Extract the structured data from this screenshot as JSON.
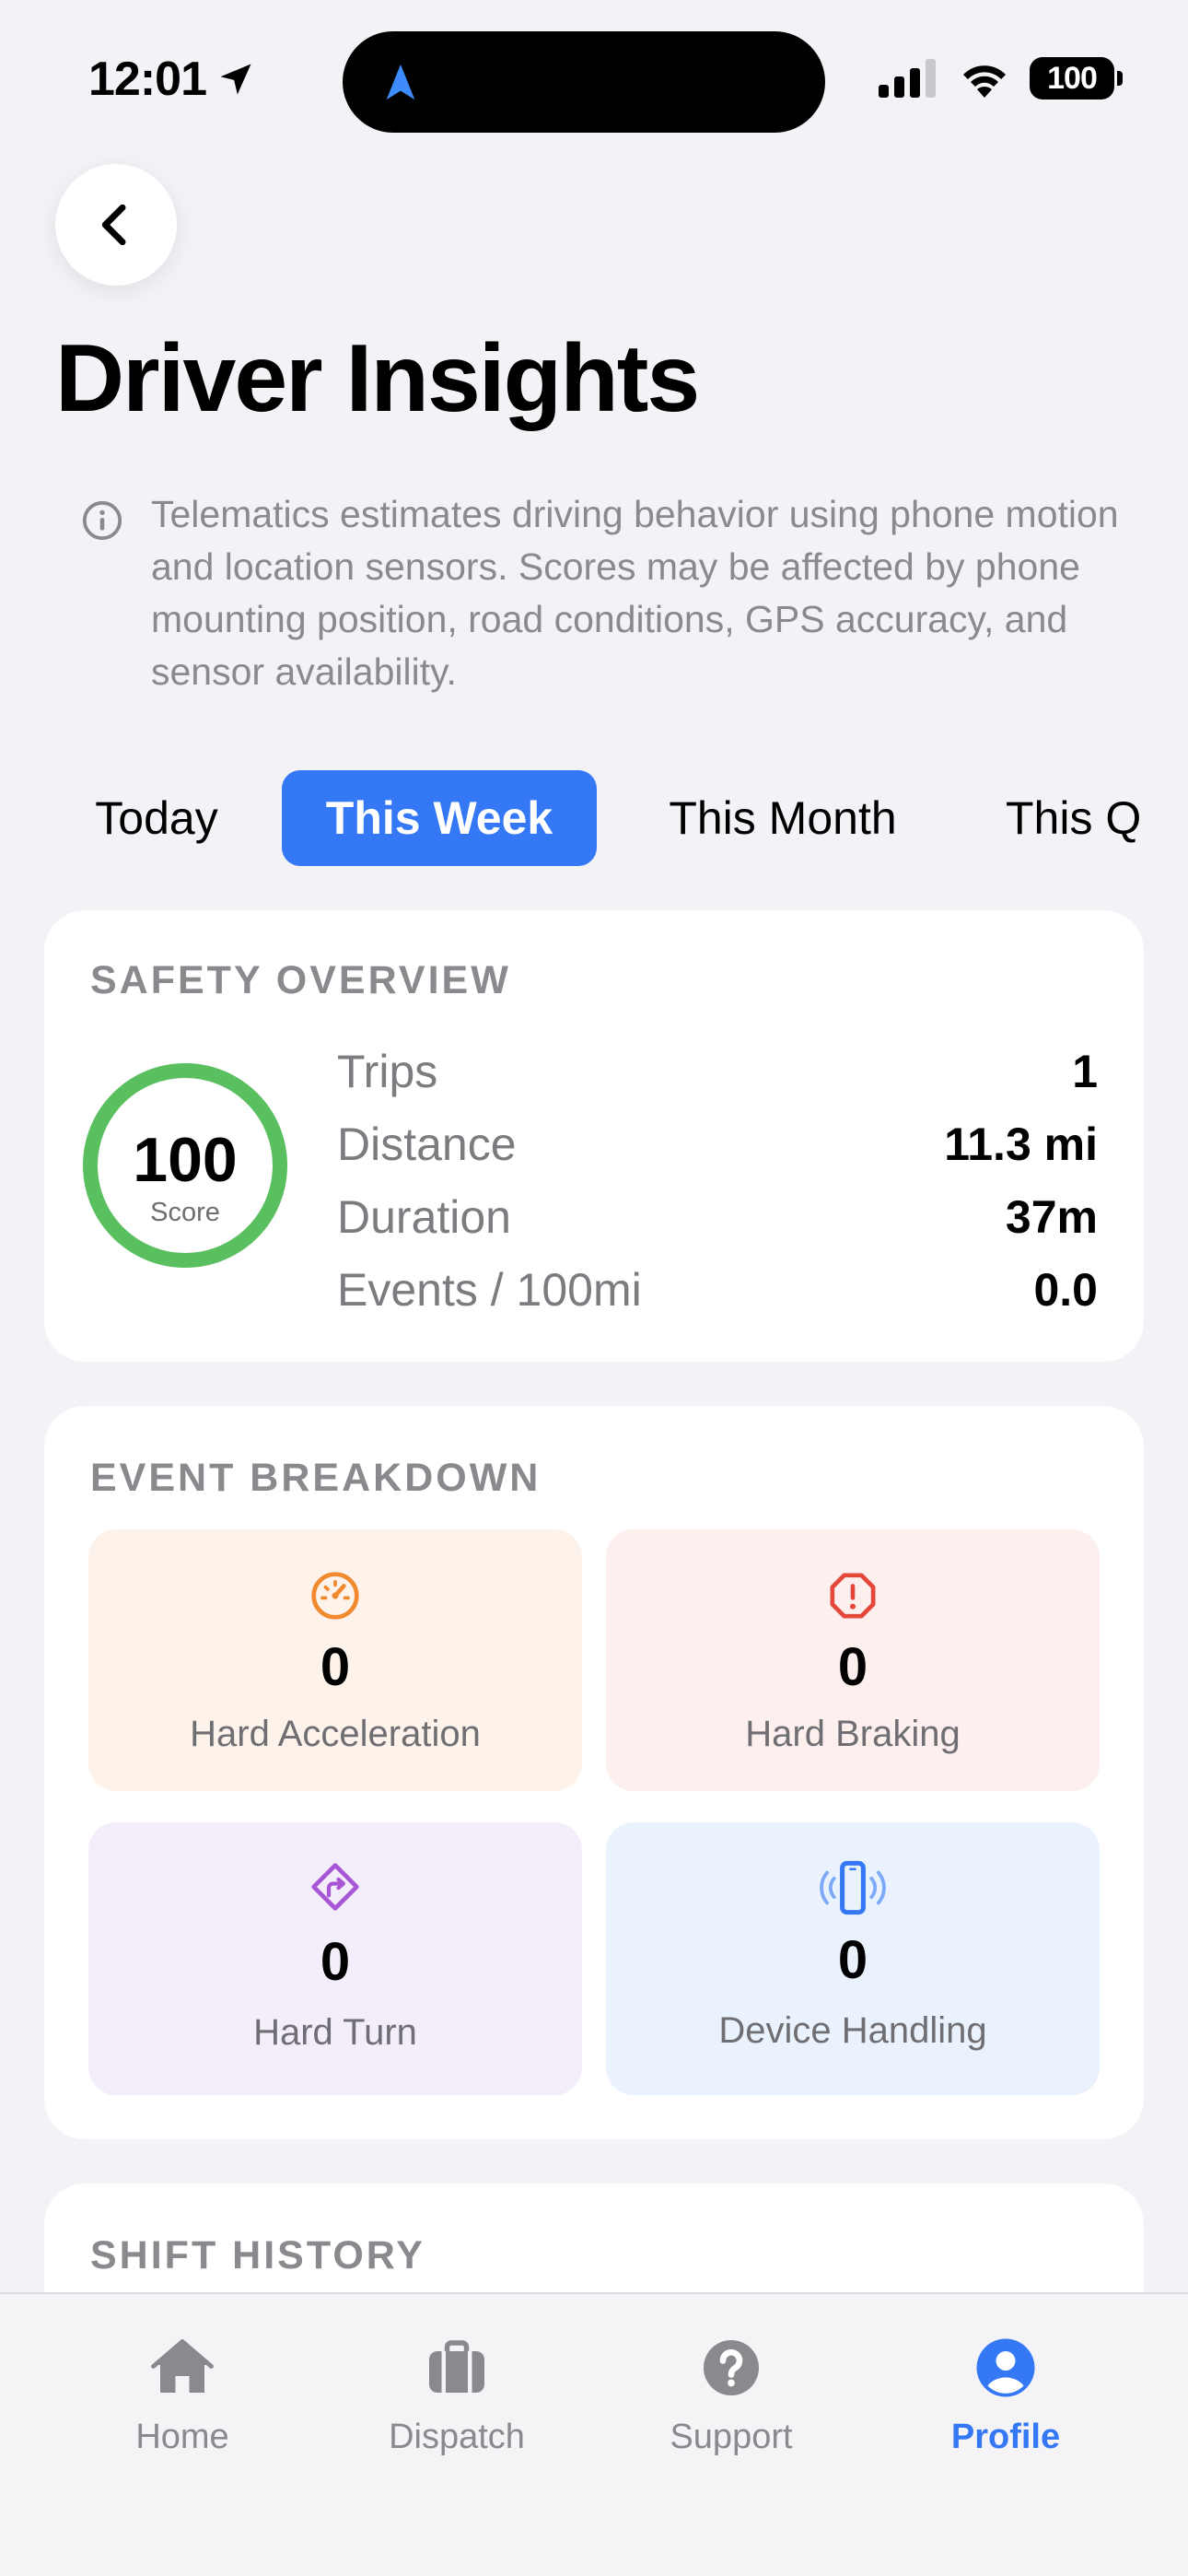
{
  "status_bar": {
    "time": "12:01",
    "battery": "100"
  },
  "header": {
    "title": "Driver Insights",
    "info_text": "Telematics estimates driving behavior using phone motion and location sensors. Scores may be affected by phone mounting position, road conditions, GPS accuracy, and sensor availability."
  },
  "period_tabs": [
    {
      "label": "Today",
      "active": false
    },
    {
      "label": "This Week",
      "active": true
    },
    {
      "label": "This Month",
      "active": false
    },
    {
      "label": "This Q",
      "active": false
    }
  ],
  "safety_overview": {
    "title": "SAFETY OVERVIEW",
    "score": "100",
    "score_label": "Score",
    "score_fraction": 1.0,
    "stats": [
      {
        "label": "Trips",
        "value": "1"
      },
      {
        "label": "Distance",
        "value": "11.3 mi"
      },
      {
        "label": "Duration",
        "value": "37m"
      },
      {
        "label": "Events / 100mi",
        "value": "0.0"
      }
    ]
  },
  "event_breakdown": {
    "title": "EVENT BREAKDOWN",
    "tiles": [
      {
        "label": "Hard Acceleration",
        "value": "0",
        "icon": "speedometer-icon",
        "color": "#f0892f",
        "bg": "#fdf3ea"
      },
      {
        "label": "Hard Braking",
        "value": "0",
        "icon": "alert-octagon-icon",
        "color": "#e5483b",
        "bg": "#fcefed"
      },
      {
        "label": "Hard Turn",
        "value": "0",
        "icon": "turn-right-sign-icon",
        "color": "#a855d6",
        "bg": "#f4eefa"
      },
      {
        "label": "Device Handling",
        "value": "0",
        "icon": "phone-vibrate-icon",
        "color": "#3478f6",
        "bg": "#eaf2fd"
      }
    ]
  },
  "shift_history": {
    "title": "SHIFT HISTORY"
  },
  "tab_bar": {
    "items": [
      {
        "label": "Home",
        "icon": "house-icon",
        "active": false
      },
      {
        "label": "Dispatch",
        "icon": "briefcase-icon",
        "active": false
      },
      {
        "label": "Support",
        "icon": "question-circle-icon",
        "active": false
      },
      {
        "label": "Profile",
        "icon": "person-circle-icon",
        "active": true
      }
    ]
  },
  "colors": {
    "accent": "#3478f6",
    "score_ring": "#5ac05f",
    "background": "#f2f2f7"
  }
}
